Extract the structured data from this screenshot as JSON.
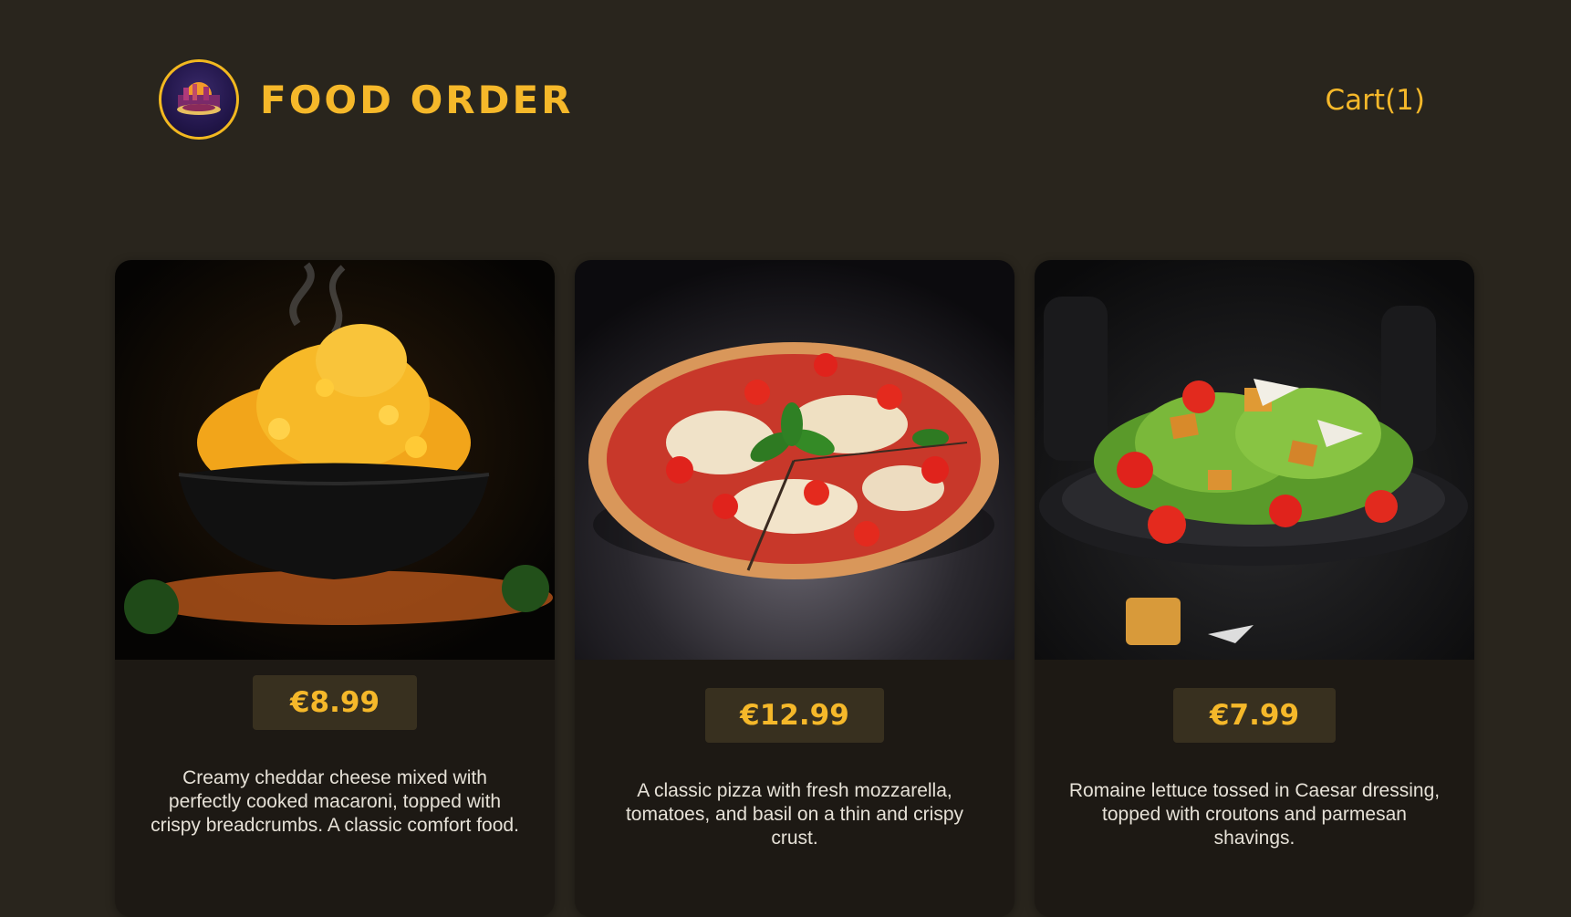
{
  "header": {
    "brand_title": "FOOD ORDER",
    "cart_label": "Cart(1)",
    "logo_icon": "restaurant-logo-icon"
  },
  "colors": {
    "background": "#29251d",
    "accent": "#f5b82a",
    "card_background": "#1d1914",
    "price_background": "#38301f",
    "text": "#e6e1d7"
  },
  "meals": [
    {
      "image_icon": "mac-and-cheese-image",
      "price": "€8.99",
      "description": "Creamy cheddar cheese mixed with perfectly cooked macaroni, topped with crispy breadcrumbs. A classic comfort food."
    },
    {
      "image_icon": "pizza-image",
      "price": "€12.99",
      "description": "A classic pizza with fresh mozzarella, tomatoes, and basil on a thin and crispy crust."
    },
    {
      "image_icon": "caesar-salad-image",
      "price": "€7.99",
      "description": "Romaine lettuce tossed in Caesar dressing, topped with croutons and parmesan shavings."
    }
  ]
}
